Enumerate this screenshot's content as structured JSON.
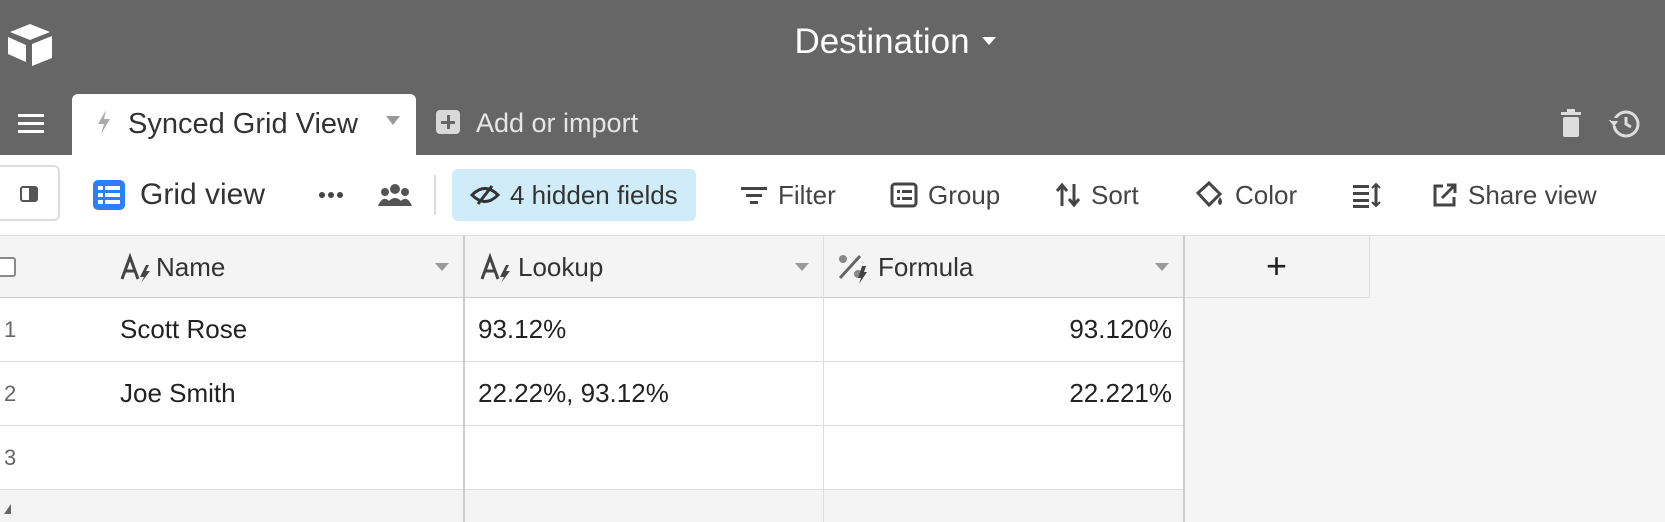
{
  "header": {
    "base_name": "Destination"
  },
  "tabs": {
    "active_label": "Synced Grid View",
    "add_import_label": "Add or import"
  },
  "toolbar": {
    "view_name": "Grid view",
    "hidden_fields": "4 hidden fields",
    "filter": "Filter",
    "group": "Group",
    "sort": "Sort",
    "color": "Color",
    "share_view": "Share view"
  },
  "grid": {
    "columns": [
      {
        "label": "Name",
        "icon": "text-lookup-icon"
      },
      {
        "label": "Lookup",
        "icon": "text-lookup-icon"
      },
      {
        "label": "Formula",
        "icon": "formula-icon"
      }
    ],
    "add_column_label": "+",
    "rows": [
      {
        "num": "1",
        "name": "Scott Rose",
        "lookup": "93.12%",
        "formula": "93.120%"
      },
      {
        "num": "2",
        "name": "Joe Smith",
        "lookup": "22.22%, 93.12%",
        "formula": "22.221%"
      },
      {
        "num": "3",
        "name": "",
        "lookup": "",
        "formula": ""
      }
    ]
  },
  "colors": {
    "header_bg": "#666666",
    "hidden_fields_bg": "#d1ecf9",
    "icon_blue": "#2d7ff9"
  }
}
